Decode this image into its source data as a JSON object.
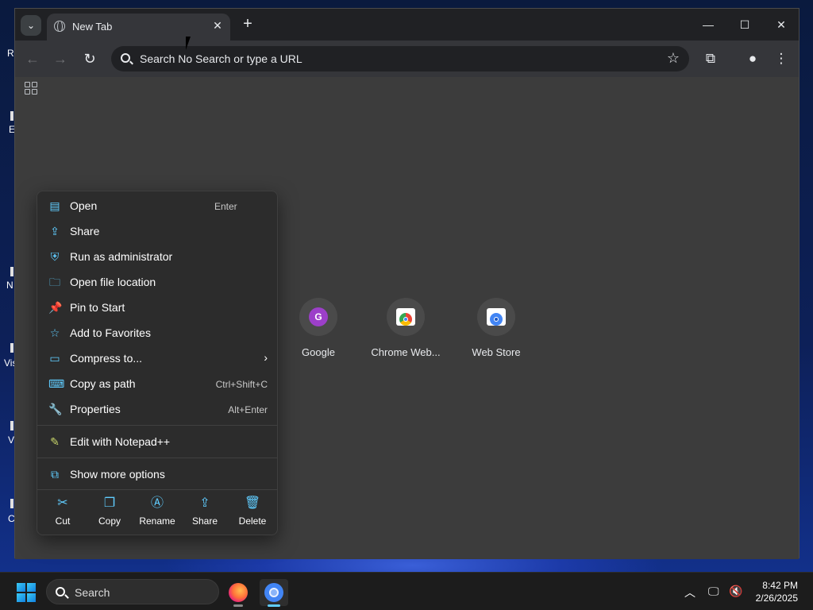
{
  "browser": {
    "tab": {
      "title": "New Tab"
    },
    "omnibox": {
      "placeholder": "Search No Search or type a URL"
    }
  },
  "desktop": {
    "icon_labels": [
      "R",
      "E",
      "N",
      "Vis",
      "V",
      "C"
    ]
  },
  "shortcuts": [
    {
      "label": "Google",
      "letter": "G"
    },
    {
      "label": "Chrome Web..."
    },
    {
      "label": "Web Store"
    }
  ],
  "context_menu": {
    "items": [
      {
        "label": "Open",
        "shortcut": "Enter",
        "icon": "window-icon"
      },
      {
        "label": "Share",
        "shortcut": "",
        "icon": "share-icon"
      },
      {
        "label": "Run as administrator",
        "shortcut": "",
        "icon": "shield-icon"
      },
      {
        "label": "Open file location",
        "shortcut": "",
        "icon": "folder-icon"
      },
      {
        "label": "Pin to Start",
        "shortcut": "",
        "icon": "pin-icon"
      },
      {
        "label": "Add to Favorites",
        "shortcut": "",
        "icon": "star-icon"
      },
      {
        "label": "Compress to...",
        "shortcut": "",
        "icon": "archive-icon"
      },
      {
        "label": "Copy as path",
        "shortcut": "Ctrl+Shift+C",
        "icon": "path-icon"
      },
      {
        "label": "Properties",
        "shortcut": "Alt+Enter",
        "icon": "wrench-icon"
      }
    ],
    "notepad": {
      "label": "Edit with Notepad++"
    },
    "more": {
      "label": "Show more options"
    },
    "actions": [
      {
        "label": "Cut"
      },
      {
        "label": "Copy"
      },
      {
        "label": "Rename"
      },
      {
        "label": "Share"
      },
      {
        "label": "Delete"
      }
    ]
  },
  "taskbar": {
    "search_label": "Search",
    "time": "8:42 PM",
    "date": "2/26/2025"
  },
  "colors": {
    "accent": "#60cdff",
    "menu_bg": "#2c2c2c",
    "browser_bg": "#3c3c3c",
    "avatar_purple": "#9c3fc9"
  }
}
